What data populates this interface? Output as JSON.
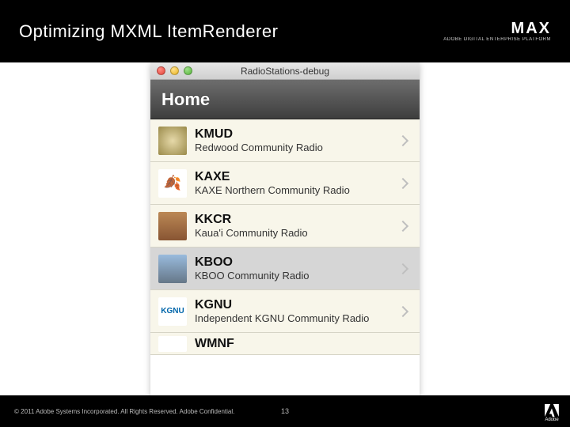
{
  "slide": {
    "title": "Optimizing MXML ItemRenderer",
    "page_number": "13",
    "copyright": "© 2011 Adobe Systems Incorporated. All Rights Reserved. Adobe Confidential.",
    "brand": {
      "name": "MAX",
      "tagline": "ADOBE DIGITAL ENTERPRISE PLATFORM"
    },
    "adobe_label": "Adobe"
  },
  "app": {
    "window_title": "RadioStations-debug",
    "header_title": "Home",
    "selected_index": 3,
    "stations": [
      {
        "code": "KMUD",
        "name": "Redwood Community Radio",
        "icon": "kmud"
      },
      {
        "code": "KAXE",
        "name": "KAXE Northern Community Radio",
        "icon": "kaxe"
      },
      {
        "code": "KKCR",
        "name": "Kaua'i Community Radio",
        "icon": "kkcr"
      },
      {
        "code": "KBOO",
        "name": "KBOO Community Radio",
        "icon": "kboo"
      },
      {
        "code": "KGNU",
        "name": "Independent KGNU Community Radio",
        "icon": "kgnu"
      },
      {
        "code": "WMNF",
        "name": "",
        "icon": "wmnf"
      }
    ]
  }
}
